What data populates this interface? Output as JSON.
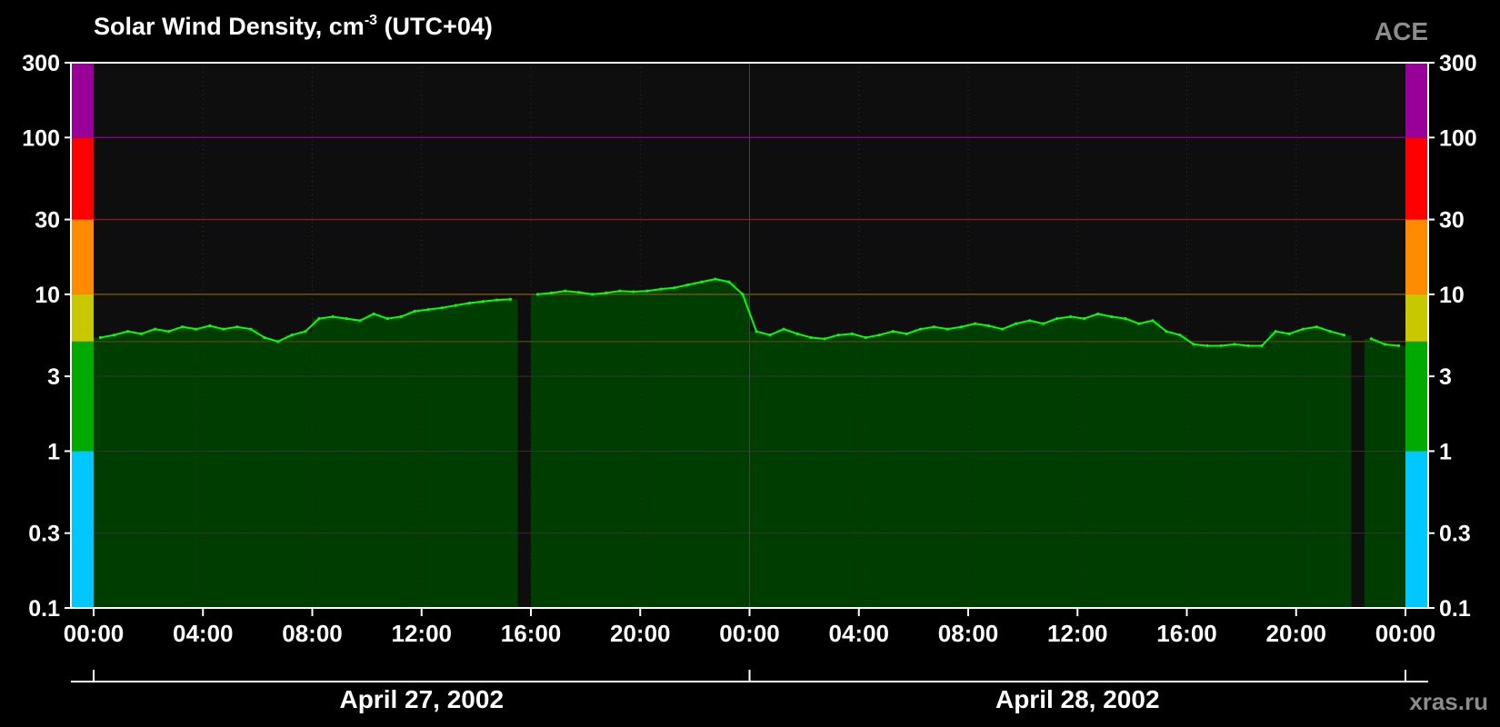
{
  "chart_data": {
    "type": "line",
    "title": "Solar Wind Density, cm",
    "title_superscript": "-3",
    "title_suffix": " (UTC+04)",
    "source_label": "ACE",
    "watermark": "xras.ru",
    "y_scale": "log",
    "ylim": [
      0.1,
      300
    ],
    "y_ticks": [
      {
        "value": 0.1,
        "label": "0.1"
      },
      {
        "value": 0.3,
        "label": "0.3"
      },
      {
        "value": 1,
        "label": "1"
      },
      {
        "value": 3,
        "label": "3"
      },
      {
        "value": 10,
        "label": "10"
      },
      {
        "value": 30,
        "label": "30"
      },
      {
        "value": 100,
        "label": "100"
      },
      {
        "value": 300,
        "label": "300"
      }
    ],
    "x_range_hours": [
      0,
      48
    ],
    "x_ticks": [
      {
        "hour": 0,
        "label": "00:00"
      },
      {
        "hour": 4,
        "label": "04:00"
      },
      {
        "hour": 8,
        "label": "08:00"
      },
      {
        "hour": 12,
        "label": "12:00"
      },
      {
        "hour": 16,
        "label": "16:00"
      },
      {
        "hour": 20,
        "label": "20:00"
      },
      {
        "hour": 24,
        "label": "00:00"
      },
      {
        "hour": 28,
        "label": "04:00"
      },
      {
        "hour": 32,
        "label": "08:00"
      },
      {
        "hour": 36,
        "label": "12:00"
      },
      {
        "hour": 40,
        "label": "16:00"
      },
      {
        "hour": 44,
        "label": "20:00"
      },
      {
        "hour": 48,
        "label": "00:00"
      }
    ],
    "dates": [
      {
        "label": "April 27, 2002",
        "start_hour": 0,
        "end_hour": 24
      },
      {
        "label": "April 28, 2002",
        "start_hour": 24,
        "end_hour": 48
      }
    ],
    "color_bands": [
      {
        "from": 0.1,
        "to": 1,
        "color": "#00c8ff"
      },
      {
        "from": 1,
        "to": 5,
        "color": "#00aa00"
      },
      {
        "from": 5,
        "to": 10,
        "color": "#c8c800"
      },
      {
        "from": 10,
        "to": 30,
        "color": "#ff8c00"
      },
      {
        "from": 30,
        "to": 100,
        "color": "#ff0000"
      },
      {
        "from": 100,
        "to": 300,
        "color": "#990099"
      }
    ],
    "threshold_lines": [
      {
        "value": 5,
        "color": "#4a4a00"
      },
      {
        "value": 10,
        "color": "#8a5a00"
      },
      {
        "value": 30,
        "color": "#8a1a1a"
      },
      {
        "value": 100,
        "color": "#8a008a"
      }
    ],
    "colors": {
      "background": "#000000",
      "plot_background": "#0e0e0e",
      "line": "#00ff00",
      "fill": "#003d00",
      "grid": "#333333",
      "text": "#ffffff",
      "muted_text": "#8c8c8c"
    },
    "series": [
      {
        "x_hours": [
          0,
          0.5,
          1,
          1.5,
          2,
          2.5,
          3,
          3.5,
          4,
          4.5,
          5,
          5.5,
          6,
          6.5,
          7,
          7.5,
          8,
          8.5,
          9,
          9.5,
          10,
          10.5,
          11,
          11.5,
          12,
          12.5,
          13,
          13.5,
          14,
          14.5,
          15,
          15.5,
          16,
          16.5,
          17,
          17.5,
          18,
          18.5,
          19,
          19.5,
          20,
          20.5,
          21,
          21.5,
          22,
          22.5,
          23,
          23.5,
          24,
          24.5,
          25,
          25.5,
          26,
          26.5,
          27,
          27.5,
          28,
          28.5,
          29,
          29.5,
          30,
          30.5,
          31,
          31.5,
          32,
          32.5,
          33,
          33.5,
          34,
          34.5,
          35,
          35.5,
          36,
          36.5,
          37,
          37.5,
          38,
          38.5,
          39,
          39.5,
          40,
          40.5,
          41,
          41.5,
          42,
          42.5,
          43,
          43.5,
          44,
          44.5,
          45,
          45.5,
          46,
          46.5,
          47,
          47.5
        ],
        "values": [
          5.3,
          5.5,
          5.8,
          5.6,
          6.0,
          5.8,
          6.2,
          6.0,
          6.3,
          6.0,
          6.2,
          6.0,
          5.3,
          5.0,
          5.5,
          5.8,
          7.0,
          7.2,
          7.0,
          6.8,
          7.5,
          7.0,
          7.2,
          7.8,
          8.0,
          8.2,
          8.5,
          8.8,
          9.0,
          9.2,
          9.3,
          null,
          10.0,
          10.2,
          10.5,
          10.3,
          10.0,
          10.2,
          10.5,
          10.4,
          10.5,
          10.8,
          11.0,
          11.5,
          12.0,
          12.5,
          12.0,
          10.0,
          5.8,
          5.5,
          6.0,
          5.6,
          5.3,
          5.2,
          5.5,
          5.6,
          5.3,
          5.5,
          5.8,
          5.6,
          6.0,
          6.2,
          6.0,
          6.2,
          6.5,
          6.3,
          6.0,
          6.5,
          6.8,
          6.5,
          7.0,
          7.2,
          7.0,
          7.5,
          7.2,
          7.0,
          6.5,
          6.8,
          5.8,
          5.5,
          4.8,
          4.7,
          4.7,
          4.8,
          4.7,
          4.7,
          5.8,
          5.6,
          6.0,
          6.2,
          5.8,
          5.5,
          null,
          5.2,
          4.8,
          4.7
        ]
      }
    ]
  }
}
